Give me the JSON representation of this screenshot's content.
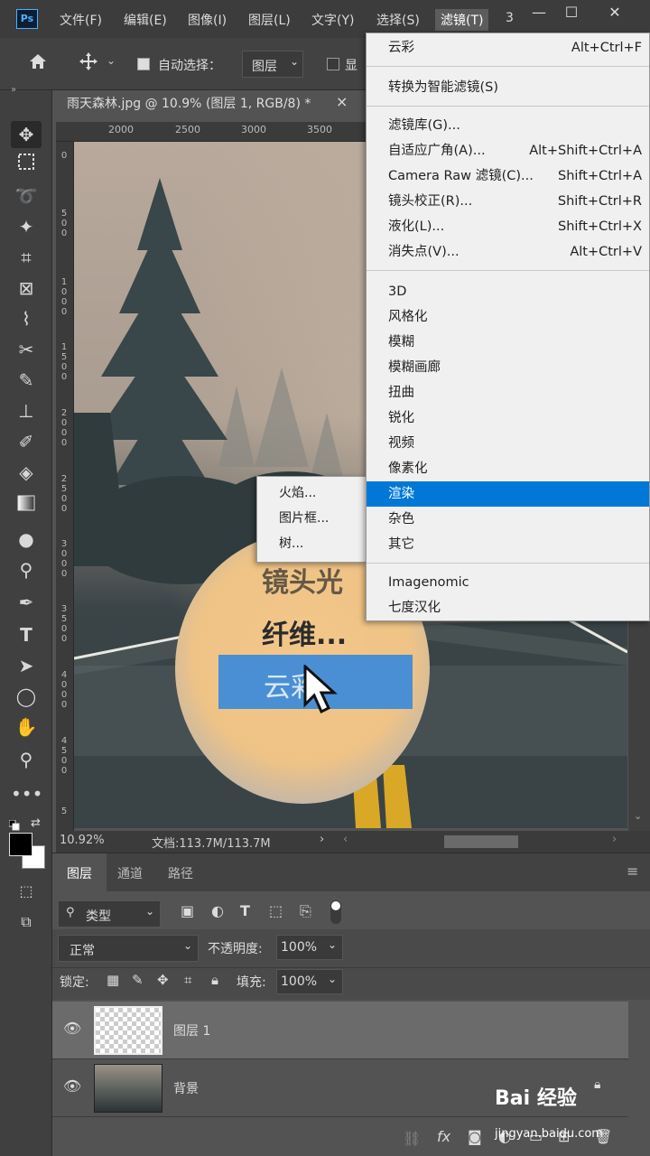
{
  "menubar": {
    "logo": "Ps",
    "items": [
      "文件(F)",
      "编辑(E)",
      "图像(I)",
      "图层(L)",
      "文字(Y)",
      "选择(S)",
      "滤镜(T)",
      "3"
    ],
    "window_buttons": [
      "—",
      "☐",
      "✕"
    ]
  },
  "options": {
    "auto_select_label": "自动选择：",
    "auto_select_value": "图层",
    "show_label": "显"
  },
  "document": {
    "tab_title": "雨天森林.jpg @ 10.9% (图层 1, RGB/8) *",
    "close": "×"
  },
  "ruler": {
    "top_ticks": [
      "2000",
      "2500",
      "3000",
      "3500"
    ],
    "left_ticks": [
      "0",
      "5\n0\n0",
      "1\n0\n0\n0",
      "1\n5\n0\n0",
      "2\n0\n0\n0",
      "2\n5\n0\n0",
      "3\n0\n0\n0",
      "3\n5\n0\n0",
      "4\n0\n0\n0",
      "4\n5\n0\n0",
      "5"
    ]
  },
  "status": {
    "zoom": "10.92%",
    "doc_size": "文档:113.7M/113.7M"
  },
  "filter_menu": {
    "top_item": {
      "label": "云彩",
      "shortcut": "Alt+Ctrl+F"
    },
    "smart": "转换为智能滤镜(S)",
    "group1": [
      {
        "label": "滤镜库(G)...",
        "shortcut": ""
      },
      {
        "label": "自适应广角(A)...",
        "shortcut": "Alt+Shift+Ctrl+A"
      },
      {
        "label": "Camera Raw 滤镜(C)...",
        "shortcut": "Shift+Ctrl+A"
      },
      {
        "label": "镜头校正(R)...",
        "shortcut": "Shift+Ctrl+R"
      },
      {
        "label": "液化(L)...",
        "shortcut": "Shift+Ctrl+X"
      },
      {
        "label": "消失点(V)...",
        "shortcut": "Alt+Ctrl+V"
      }
    ],
    "group2": [
      "3D",
      "风格化",
      "模糊",
      "模糊画廊",
      "扭曲",
      "锐化",
      "视频",
      "像素化",
      "渲染",
      "杂色",
      "其它"
    ],
    "highlighted": "渲染",
    "group3": [
      "Imagenomic",
      "七度汉化"
    ]
  },
  "submenu": {
    "items": [
      "火焰...",
      "图片框...",
      "树..."
    ]
  },
  "magnifier": {
    "line1": "镜头光",
    "line2": "纤维...",
    "line3": "云彩"
  },
  "layers_panel": {
    "tabs": [
      "图层",
      "通道",
      "路径"
    ],
    "filter_label": "类型",
    "blend_mode": "正常",
    "opacity_label": "不透明度:",
    "opacity_value": "100%",
    "lock_label": "锁定:",
    "fill_label": "填充:",
    "fill_value": "100%",
    "layers": [
      {
        "name": "图层 1",
        "selected": true
      },
      {
        "name": "背景",
        "selected": false
      }
    ]
  },
  "watermark": {
    "brand": "Bai 经验",
    "url": "jingyan.baidu.com"
  }
}
